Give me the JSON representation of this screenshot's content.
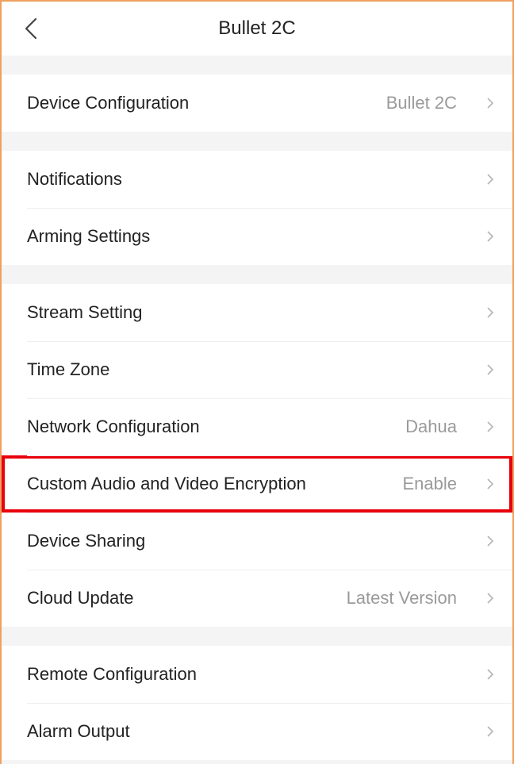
{
  "header": {
    "title": "Bullet 2C",
    "back_icon": "chevron-left-icon"
  },
  "colors": {
    "highlight": "#e8000b",
    "frame": "#f0a060",
    "value_text": "#9a9a9a"
  },
  "groups": [
    {
      "items": [
        {
          "label": "Device Configuration",
          "value": "Bullet 2C"
        }
      ]
    },
    {
      "items": [
        {
          "label": "Notifications",
          "value": ""
        },
        {
          "label": "Arming Settings",
          "value": ""
        }
      ]
    },
    {
      "items": [
        {
          "label": "Stream Setting",
          "value": ""
        },
        {
          "label": "Time Zone",
          "value": ""
        },
        {
          "label": "Network Configuration",
          "value": "Dahua"
        },
        {
          "label": "Custom Audio and Video Encryption",
          "value": "Enable",
          "highlighted": true
        },
        {
          "label": "Device Sharing",
          "value": ""
        },
        {
          "label": "Cloud Update",
          "value": "Latest Version"
        }
      ]
    },
    {
      "items": [
        {
          "label": "Remote Configuration",
          "value": ""
        },
        {
          "label": "Alarm Output",
          "value": ""
        }
      ]
    }
  ]
}
